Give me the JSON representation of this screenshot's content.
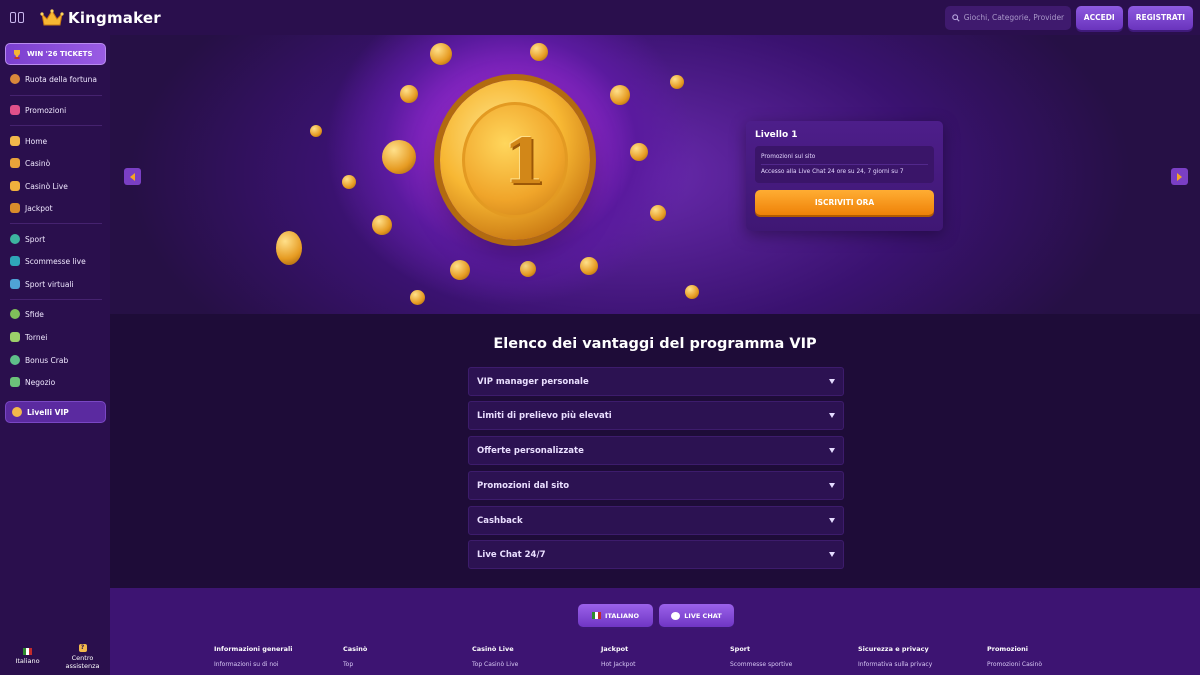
{
  "header": {
    "brand": "Kingmaker",
    "search_placeholder": "Giochi, Categorie, Provider",
    "login_label": "ACCEDI",
    "register_label": "REGISTRATI"
  },
  "sidebar": {
    "promo_banner": "WIN '26 TICKETS",
    "items": [
      {
        "label": "Ruota della fortuna",
        "icon": "wheel-icon"
      },
      {
        "label": "Promozioni",
        "icon": "gift-icon"
      },
      {
        "label": "Home",
        "icon": "home-icon"
      },
      {
        "label": "Casinò",
        "icon": "casino-icon"
      },
      {
        "label": "Casinò Live",
        "icon": "live-casino-icon"
      },
      {
        "label": "Jackpot",
        "icon": "jackpot-icon"
      },
      {
        "label": "Sport",
        "icon": "sport-icon"
      },
      {
        "label": "Scommesse live",
        "icon": "live-bet-icon"
      },
      {
        "label": "Sport virtuali",
        "icon": "virtual-sport-icon"
      },
      {
        "label": "Sfide",
        "icon": "challenge-icon"
      },
      {
        "label": "Tornei",
        "icon": "trophy-icon"
      },
      {
        "label": "Bonus Crab",
        "icon": "crab-icon"
      },
      {
        "label": "Negozio",
        "icon": "shop-icon"
      }
    ],
    "vip_label": "Livelli VIP",
    "language_label": "Italiano",
    "help_label": "Centro assistenza"
  },
  "hero": {
    "coin_number": "1",
    "level_card": {
      "title": "Livello 1",
      "benefits": [
        "Promozioni sul sito",
        "Accesso alla Live Chat 24 ore su 24, 7 giorni su 7"
      ],
      "cta_label": "ISCRIVITI ORA"
    }
  },
  "main": {
    "title": "Elenco dei vantaggi del programma VIP",
    "benefits": [
      "VIP manager personale",
      "Limiti di prelievo più elevati",
      "Offerte personalizzate",
      "Promozioni dal sito",
      "Cashback",
      "Live Chat 24/7"
    ]
  },
  "footer": {
    "language_button": "ITALIANO",
    "live_chat_button": "LIVE CHAT",
    "columns": [
      {
        "heading": "Informazioni generali",
        "link": "Informazioni su di noi"
      },
      {
        "heading": "Casinò",
        "link": "Top"
      },
      {
        "heading": "Casinò Live",
        "link": "Top Casinò Live"
      },
      {
        "heading": "Jackpot",
        "link": "Hot Jackpot"
      },
      {
        "heading": "Sport",
        "link": "Scommesse sportive"
      },
      {
        "heading": "Sicurezza e privacy",
        "link": "Informativa sulla privacy"
      },
      {
        "heading": "Promozioni",
        "link": "Promozioni Casinò"
      }
    ]
  },
  "colors": {
    "accent_orange": "#ef8208",
    "accent_purple": "#7a3fc4",
    "background": "#1c0b33"
  }
}
